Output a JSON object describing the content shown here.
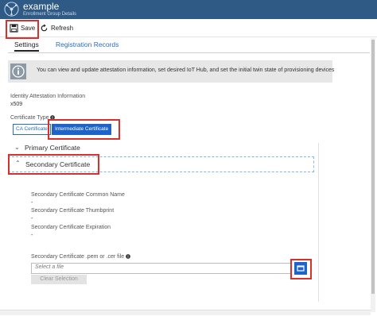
{
  "header": {
    "title": "example",
    "subtitle": "Enrollment Group Details",
    "bg_color": "#2f5a86"
  },
  "toolbar": {
    "save_label": "Save",
    "save_icon": "floppy-disk-icon",
    "refresh_label": "Refresh",
    "refresh_icon": "refresh-icon"
  },
  "tabs": [
    {
      "label": "Settings",
      "active": true
    },
    {
      "label": "Registration Records",
      "active": false
    }
  ],
  "info": {
    "icon": "info-icon",
    "text": "You can view and update attestation information, set desired IoT Hub, and set the initial twin state of provisioning devices"
  },
  "attestation": {
    "label": "Identity Attestation Information",
    "value": "x509"
  },
  "certificate_type": {
    "label": "Certificate Type",
    "options": [
      "CA Certificate",
      "Intermediate Certificate"
    ],
    "selected": "Intermediate Certificate"
  },
  "sections": {
    "primary": "Primary Certificate",
    "secondary": "Secondary Certificate"
  },
  "secondary_fields": {
    "common_name_label": "Secondary Certificate Common Name",
    "common_name_value": "-",
    "thumbprint_label": "Secondary Certificate Thumbprint",
    "thumbprint_value": "-",
    "expiration_label": "Secondary Certificate Expiration",
    "expiration_value": "-"
  },
  "file_upload": {
    "label": "Secondary Certificate .pem or .cer file",
    "placeholder": "Select a file",
    "clear_label": "Clear Selection"
  },
  "colors": {
    "accent": "#1e63c8",
    "highlight": "#d9302c"
  }
}
